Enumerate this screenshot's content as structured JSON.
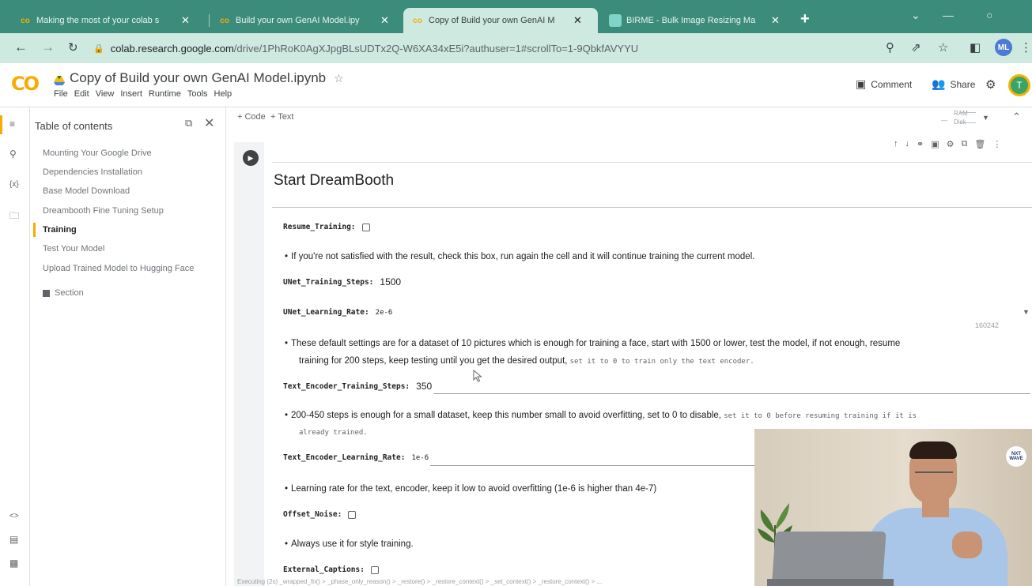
{
  "browser": {
    "tabs": [
      {
        "title": "Making the most of your colab s",
        "active": false
      },
      {
        "title": "Build your own GenAI Model.ipy",
        "active": false
      },
      {
        "title": "Copy of Build your own GenAI M",
        "active": true
      },
      {
        "title": "BIRME - Bulk Image Resizing Ma",
        "active": false
      }
    ],
    "tab_close_glyph": "✕",
    "new_tab_glyph": "+",
    "url_host": "colab.research.google.com",
    "url_path": "/drive/1PhRoK0AgXJpgBLsUDTx2Q-W6XA34xE5i?authuser=1#scrollTo=1-9QbkfAVYYU",
    "profile_initials": "ML"
  },
  "colab": {
    "logo": "CO",
    "notebook_title": "Copy of Build your own GenAI Model.ipynb",
    "menus": [
      "File",
      "Edit",
      "View",
      "Insert",
      "Runtime",
      "Tools",
      "Help"
    ],
    "comment_label": "Comment",
    "share_label": "Share",
    "user_initial": "T"
  },
  "toc": {
    "title": "Table of contents",
    "items": [
      {
        "label": "Mounting Your Google Drive",
        "active": false
      },
      {
        "label": "Dependencies Installation",
        "active": false
      },
      {
        "label": "Base Model Download",
        "active": false
      },
      {
        "label": "Dreambooth Fine Tuning Setup",
        "active": false
      },
      {
        "label": "Training",
        "active": true
      },
      {
        "label": "Test Your Model",
        "active": false
      },
      {
        "label": "Upload Trained Model to Hugging Face",
        "active": false
      }
    ],
    "section_label": "Section"
  },
  "toolbar": {
    "code_label": "+ Code",
    "text_label": "+ Text",
    "ram_label": "RAM",
    "disk_label": "Disk"
  },
  "cell": {
    "heading": "Start DreamBooth",
    "params": {
      "resume_training": {
        "name": "Resume_Training:"
      },
      "unet_training_steps": {
        "name": "UNet_Training_Steps:",
        "value": "1500"
      },
      "unet_learning_rate": {
        "name": "UNet_Learning_Rate:",
        "value": "2e-6"
      },
      "text_encoder_training_steps": {
        "name": "Text_Encoder_Training_Steps:",
        "value": "350"
      },
      "text_encoder_learning_rate": {
        "name": "Text_Encoder_Learning_Rate:",
        "value": "1e-6"
      },
      "offset_noise": {
        "name": "Offset_Noise:"
      },
      "external_captions": {
        "name": "External_Captions:"
      }
    },
    "bullets": {
      "resume": "If you're not satisfied with the result, check this box, run again the cell and it will continue training the current model.",
      "defaults_line1": "These default settings are for a dataset of 10 pictures which is enough for training a face, start with 1500 or lower, test the model, if not enough, resume",
      "defaults_line2_text": "training for 200 steps, keep testing until you get the desired output, ",
      "defaults_line2_code": "set it to 0 to train only the text encoder.",
      "encoder_line1_text": "200-450 steps is enough for a small dataset, keep this number small to avoid overfitting, set to 0 to disable, ",
      "encoder_line1_code": "set it to 0 before resuming training if it is",
      "encoder_line2_code": "already trained.",
      "lr": "Learning rate for the text, encoder, keep it low to avoid overfitting (1e-6 is higher than 4e-7)",
      "offset": "Always use it for style training."
    },
    "counter": "160242",
    "status_text": "Executing (2s) _wrapped_fn() > _phase_only_reason() > _restore() > _restore_context() > _set_context() > _restore_context() > ..."
  },
  "webcam": {
    "logo_text": "NXT WAVE"
  }
}
